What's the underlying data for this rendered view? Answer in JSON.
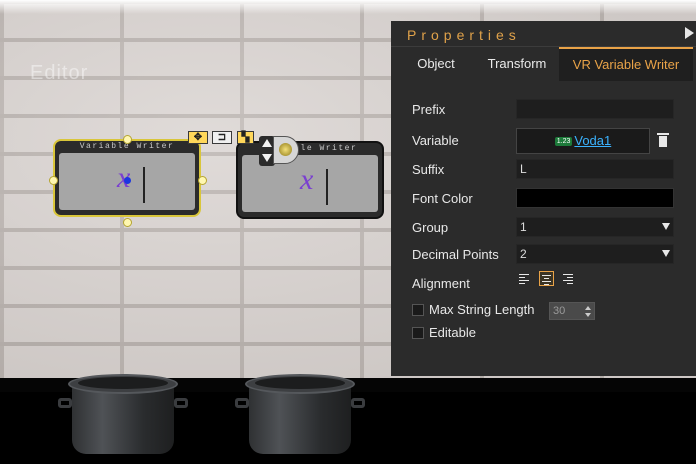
{
  "scene": {
    "background_text": "Editor",
    "widgets": [
      {
        "header": "Variable Writer",
        "symbol": "x"
      },
      {
        "header": "Variable Writer",
        "symbol": "x"
      }
    ]
  },
  "panel": {
    "title": "Properties",
    "tabs": [
      {
        "label": "Object",
        "active": false
      },
      {
        "label": "Transform",
        "active": false
      },
      {
        "label": "VR Variable Writer",
        "active": true
      }
    ],
    "fields": {
      "prefix": {
        "label": "Prefix",
        "value": ""
      },
      "variable": {
        "label": "Variable",
        "badge": "1.23",
        "value": "Voda1"
      },
      "suffix": {
        "label": "Suffix",
        "value": "L"
      },
      "font_color": {
        "label": "Font Color",
        "value": "#000000"
      },
      "group": {
        "label": "Group",
        "value": "1"
      },
      "decimal_points": {
        "label": "Decimal Points",
        "value": "2"
      },
      "alignment": {
        "label": "Alignment",
        "selected": "center"
      },
      "max_string_length": {
        "label": "Max String Length",
        "checked": false,
        "value": "30"
      },
      "editable": {
        "label": "Editable",
        "checked": false
      }
    },
    "colors": {
      "accent": "#e9a348",
      "link": "#3bb3ff",
      "selection": "#d9c63a"
    }
  }
}
